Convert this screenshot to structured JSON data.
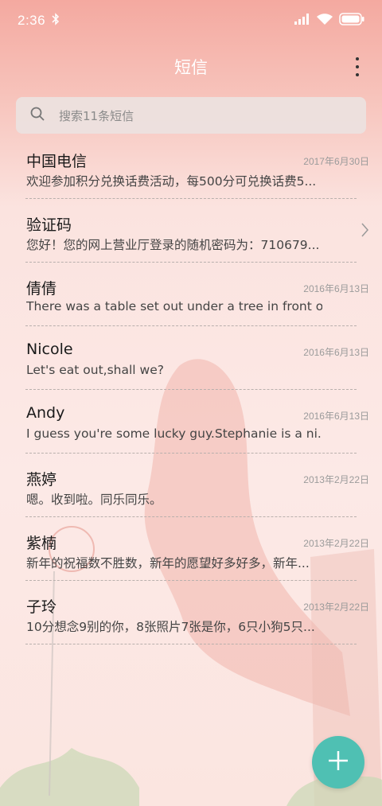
{
  "status_bar": {
    "time": "2:36",
    "icons": [
      "bluetooth-icon",
      "signal-icon",
      "wifi-icon",
      "battery-icon"
    ]
  },
  "header": {
    "title": "短信",
    "menu_icon": "more-vertical-icon"
  },
  "search": {
    "placeholder": "搜索11条短信",
    "icon": "search-icon"
  },
  "messages": [
    {
      "name": "中国电信",
      "date": "2017年6月30日",
      "preview": "欢迎参加积分兑换话费活动，每500分可兑换话费5..."
    },
    {
      "name": "验证码",
      "date": "",
      "preview": "您好！您的网上营业厅登录的随机密码为：710679...",
      "has_chevron": true
    },
    {
      "name": "倩倩",
      "date": "2016年6月13日",
      "preview": "There was a table set out under a tree in front of ..."
    },
    {
      "name": "Nicole",
      "date": "2016年6月13日",
      "preview": "Let's eat out,shall we?"
    },
    {
      "name": "Andy",
      "date": "2016年6月13日",
      "preview": "I guess you're some lucky guy.Stephanie is a ni..."
    },
    {
      "name": "燕婷",
      "date": "2013年2月22日",
      "preview": "嗯。收到啦。同乐同乐。"
    },
    {
      "name": "紫楠",
      "date": "2013年2月22日",
      "preview": "新年的祝福数不胜数，新年的愿望好多好多，新年..."
    },
    {
      "name": "子玲",
      "date": "2013年2月22日",
      "preview": "10分想念9别的你，8张照片7张是你，6只小狗5只..."
    }
  ],
  "fab": {
    "icon": "plus-icon"
  },
  "colors": {
    "header_pink": "#f4a9a0",
    "fab_teal": "#4fc0b3"
  }
}
